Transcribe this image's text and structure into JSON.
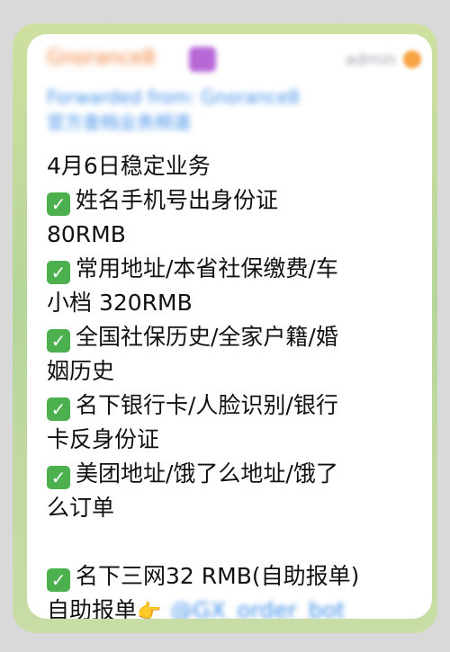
{
  "header": {
    "sender_name": "Gnorance8",
    "admin_label": "admin"
  },
  "forward": {
    "line1": "Forwarded from: Gnorance8",
    "line2": "官方查档业务频道"
  },
  "message": {
    "title": "4月6日稳定业务",
    "items": [
      {
        "lines": [
          "✅ 姓名手机号出身份证",
          "80RMB"
        ]
      },
      {
        "lines": [
          "✅ 常用地址/本省社保缴费/车",
          "小档 320RMB"
        ]
      },
      {
        "lines": [
          "✅ 全国社保历史/全家户籍/婚",
          "姻历史"
        ]
      },
      {
        "lines": [
          "✅ 名下银行卡/人脸识别/银行",
          "卡反身份证"
        ]
      },
      {
        "lines": [
          "✅ 美团地址/饿了么地址/饿了",
          "么订单"
        ]
      }
    ],
    "special_item_line": "✅ 名下三网32 RMB(自助报单)",
    "bot_line_text": "自助报单",
    "bot_mention": "@GX_order_bot"
  },
  "colors": {
    "accent_orange": "#f07a2f",
    "link_blue": "#3f8ee8",
    "check_green": "#4cb04f"
  }
}
